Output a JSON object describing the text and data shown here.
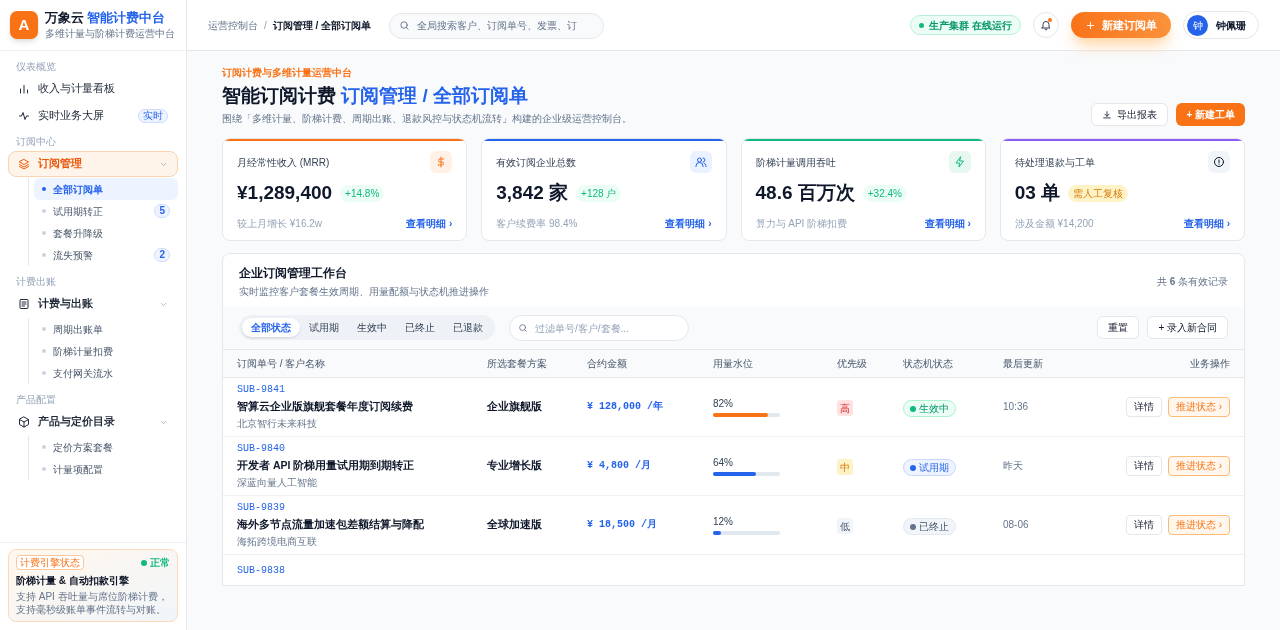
{
  "brand": {
    "logo": "A",
    "name": "万象云",
    "name_accent": "智能计费中台",
    "tagline": "多维计量与阶梯计费运营中台"
  },
  "sidebar": {
    "sections": [
      {
        "title": "仪表概览",
        "items": [
          {
            "label": "收入与计量看板",
            "kind": "bars",
            "selected": false
          },
          {
            "label": "实时业务大屏",
            "kind": "pulse",
            "selected": false,
            "badge": "实时"
          }
        ]
      },
      {
        "title": "订阅中心",
        "items": [
          {
            "label": "订阅管理",
            "kind": "layers",
            "selected": true,
            "expanded": true,
            "children": [
              {
                "label": "全部订阅单",
                "selected": true
              },
              {
                "label": "试用期转正",
                "selected": false,
                "badge": "5"
              },
              {
                "label": "套餐升降级",
                "selected": false
              },
              {
                "label": "流失预警",
                "selected": false,
                "badge": "2"
              }
            ]
          }
        ]
      },
      {
        "title": "计费出账",
        "items": [
          {
            "label": "计费与出账",
            "kind": "doc",
            "selected": false,
            "expanded": true,
            "children": [
              {
                "label": "周期出账单",
                "selected": false
              },
              {
                "label": "阶梯计量扣费",
                "selected": false
              },
              {
                "label": "支付网关流水",
                "selected": false
              }
            ]
          }
        ]
      },
      {
        "title": "产品配置",
        "items": [
          {
            "label": "产品与定价目录",
            "kind": "cube",
            "selected": false,
            "expanded": true,
            "children": [
              {
                "label": "定价方案套餐",
                "selected": false
              },
              {
                "label": "计量项配置",
                "selected": false
              }
            ]
          }
        ]
      }
    ],
    "engine": {
      "tag": "计费引擎状态",
      "status": "正常",
      "title": "阶梯计量 & 自动扣款引擎",
      "desc": "支持 API 吞吐量与席位阶梯计费，支持毫秒级账单事件流转与对账。"
    }
  },
  "header": {
    "breadcrumb": [
      "运营控制台",
      "订阅管理 / 全部订阅单"
    ],
    "breadcrumb_separator": "/",
    "search": {
      "placeholder": "全局搜索客户、订阅单号、发票、订"
    },
    "cluster_status": "生产集群 在线运行",
    "notifications": true,
    "new_button": "新建订阅单",
    "user": {
      "initial": "钟",
      "name": "钟佩珊"
    }
  },
  "page": {
    "eyebrow": "订阅计费与多维计量运营中台",
    "title": "智能订阅计费",
    "title_accent": "订阅管理 / 全部订阅单",
    "subtitle": "围绕「多维计量、阶梯计费、周期出账、退款风控与状态机流转」构建的企业级运营控制台。",
    "export_button": "导出报表",
    "ticket_button": "+ 新建工单"
  },
  "stats": [
    {
      "label": "月经常性收入 (MRR)",
      "kind": "dollar",
      "color": "#f97316",
      "value": "¥1,289,400",
      "badge": {
        "text": "+14.8%",
        "kind": "success"
      },
      "note": "较上月增长 ¥16.2w",
      "link": "查看明细 ›"
    },
    {
      "label": "有效订阅企业总数",
      "kind": "users",
      "color": "#2563eb",
      "value": "3,842 家",
      "badge": {
        "text": "+128 户",
        "kind": "success"
      },
      "note": "客户续费率 98.4%",
      "link": "查看明细 ›"
    },
    {
      "label": "阶梯计量调用吞吐",
      "kind": "bolt",
      "color": "#10b981",
      "value": "48.6 百万次",
      "badge": {
        "text": "+32.4%",
        "kind": "success"
      },
      "note": "算力与 API 阶梯扣费",
      "link": "查看明细 ›"
    },
    {
      "label": "待处理退款与工单",
      "kind": "alert",
      "color": "#8b5cf6",
      "value": "03 单",
      "badge": {
        "text": "需人工复核",
        "kind": "warning"
      },
      "note": "涉及金额 ¥14,200",
      "link": "查看明细 ›"
    }
  ],
  "workbench": {
    "title": "企业订阅管理工作台",
    "subtitle": "实时监控客户套餐生效周期、用量配额与状态机推进操作",
    "count": "共 **6** 条有效记录",
    "filters": [
      {
        "label": "全部状态",
        "selected": true
      },
      {
        "label": "试用期",
        "selected": false
      },
      {
        "label": "生效中",
        "selected": false
      },
      {
        "label": "已终止",
        "selected": false
      },
      {
        "label": "已退款",
        "selected": false
      }
    ],
    "filter_search": {
      "placeholder": "过滤单号/客户/套餐..."
    },
    "reset_button": "重置",
    "add_button": "+ 录入新合同",
    "columns": [
      "订阅单号 / 客户名称",
      "所选套餐方案",
      "合约金额",
      "用量水位",
      "优先级",
      "状态机状态",
      "最后更新",
      "业务操作"
    ],
    "rows": [
      {
        "id": "SUB-9841",
        "title": "智算云企业版旗舰套餐年度订阅续费",
        "customer": "北京智行未来科技",
        "plan": "企业旗舰版",
        "amount": "¥ 128,000 /年",
        "usage": {
          "reading": "82%",
          "level": 0.82,
          "color": "#f97316"
        },
        "priority": {
          "text": "高",
          "kind": "high"
        },
        "status": {
          "text": "生效中",
          "kind": "active"
        },
        "updated": "10:36",
        "actions": [
          "详情",
          "推进状态 ›"
        ]
      },
      {
        "id": "SUB-9840",
        "title": "开发者 API 阶梯用量试用期到期转正",
        "customer": "深蓝向量人工智能",
        "plan": "专业增长版",
        "amount": "¥ 4,800 /月",
        "usage": {
          "reading": "64%",
          "level": 0.64,
          "color": "#2563eb"
        },
        "priority": {
          "text": "中",
          "kind": "medium"
        },
        "status": {
          "text": "试用期",
          "kind": "trial"
        },
        "updated": "昨天",
        "actions": [
          "详情",
          "推进状态 ›"
        ]
      },
      {
        "id": "SUB-9839",
        "title": "海外多节点流量加速包差额结算与降配",
        "customer": "海拓跨境电商互联",
        "plan": "全球加速版",
        "amount": "¥ 18,500 /月",
        "usage": {
          "reading": "12%",
          "level": 0.12,
          "color": "#2563eb"
        },
        "priority": {
          "text": "低",
          "kind": "low"
        },
        "status": {
          "text": "已终止",
          "kind": "ended"
        },
        "updated": "08-06",
        "actions": [
          "详情",
          "推进状态 ›"
        ]
      },
      {
        "id": "SUB-9838"
      }
    ]
  }
}
